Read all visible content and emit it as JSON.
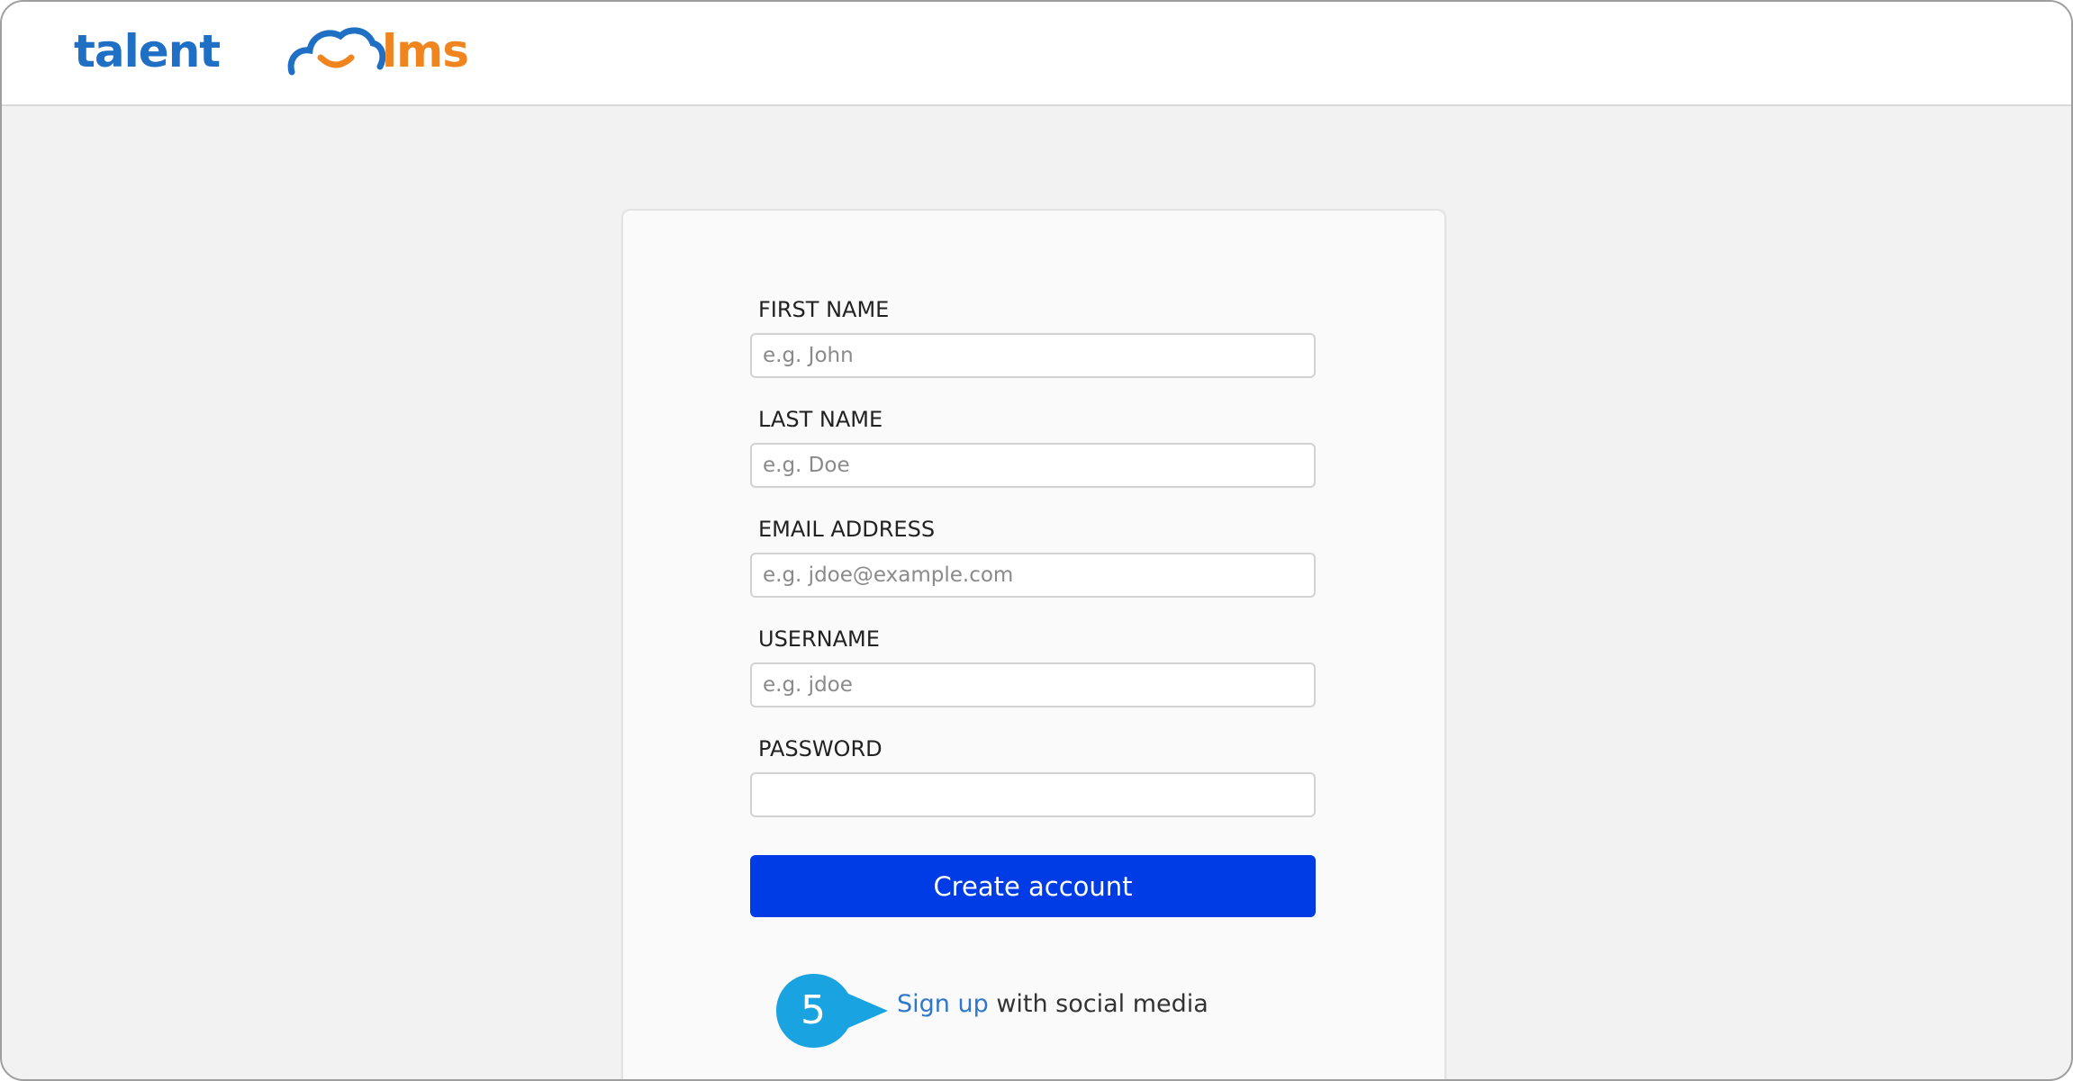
{
  "brand": {
    "logo_left": "talent",
    "logo_right": "lms",
    "primary_color": "#1f6fc4",
    "accent_color": "#f0851f",
    "button_color": "#003ce5"
  },
  "form": {
    "fields": [
      {
        "label": "FIRST NAME",
        "placeholder": "e.g. John",
        "value": ""
      },
      {
        "label": "LAST NAME",
        "placeholder": "e.g. Doe",
        "value": ""
      },
      {
        "label": "EMAIL ADDRESS",
        "placeholder": "e.g. jdoe@example.com",
        "value": ""
      },
      {
        "label": "USERNAME",
        "placeholder": "e.g. jdoe",
        "value": ""
      },
      {
        "label": "PASSWORD",
        "placeholder": "",
        "value": ""
      }
    ],
    "submit_label": "Create account"
  },
  "social": {
    "link_text": "Sign up",
    "suffix_text": " with social media"
  },
  "callout": {
    "number": "5",
    "color": "#19a3e0"
  }
}
